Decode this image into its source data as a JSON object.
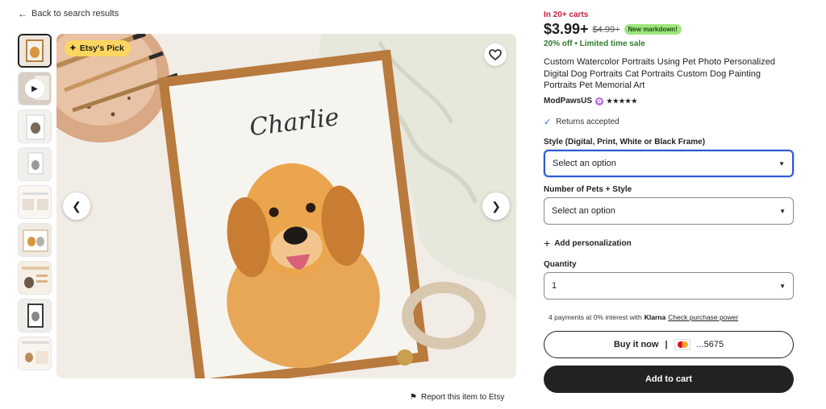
{
  "nav": {
    "back_label": "Back to search results"
  },
  "gallery": {
    "badge": "Etsy's Pick",
    "thumb_count": 10,
    "active_index": 0
  },
  "report": {
    "label": "Report this item to Etsy"
  },
  "product": {
    "carts_text": "In 20+ carts",
    "price": "$3.99+",
    "original_price": "$4.99+",
    "markdown_badge": "New markdown!",
    "sale_text": "20% off  •  Limited time sale",
    "title": "Custom Watercolor Portraits Using Pet Photo Personalized Digital Dog Portraits Cat Portraits Custom Dog Painting Portraits Pet Memorial Art",
    "shop_name": "ModPawsUS",
    "rating_stars": "★★★★★",
    "rating_value": 5,
    "returns": "Returns accepted"
  },
  "options": {
    "style_label": "Style (Digital, Print, White or Black Frame)",
    "style_value": "Select an option",
    "pets_label": "Number of Pets + Style",
    "pets_value": "Select an option",
    "personalization": "Add personalization",
    "quantity_label": "Quantity",
    "quantity_value": "1"
  },
  "payment": {
    "klarna_prefix": "4 payments at 0% interest with",
    "klarna_brand": "Klarna",
    "klarna_link": "Check purchase power",
    "buy_now": "Buy it now",
    "card_last4": "...5675",
    "add_to_cart": "Add to cart"
  },
  "colors": {
    "sale_red": "#c1213f",
    "sale_green": "#2f7c2f",
    "markdown_bg": "#9ee57d",
    "badge_bg": "#fcd65f",
    "focus_blue": "#2d5bd6",
    "cart_button": "#222222"
  }
}
